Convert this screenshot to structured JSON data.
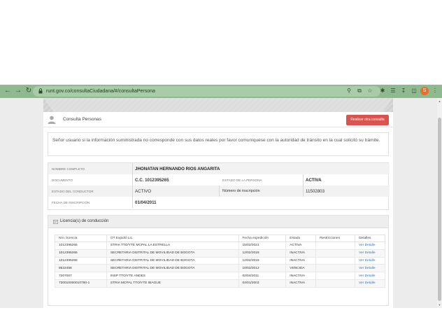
{
  "browser": {
    "url": "runt.gov.co/consultaCiudadana/#/consultaPersona",
    "avatar_letter": "S",
    "accent": "#8fb98f"
  },
  "header": {
    "title": "Consulta Personas",
    "action_button": "Realizar otra consulta"
  },
  "notice": {
    "text": "Señor usuario si la información suministrada no corresponde con sus datos reales por favor comuníquese con la autoridad de tránsito en la cual solicitó su trámite."
  },
  "person": {
    "nombre_label": "NOMBRE COMPLETO",
    "nombre_value": "JHONATAN HERNANDO RIOS ANGARITA",
    "documento_label": "DOCUMENTO",
    "documento_value": "C.C. 1012395265",
    "estado_persona_label": "ESTADO DE LA PERSONA",
    "estado_persona_value": "ACTIVA",
    "estado_conductor_label": "ESTADO DEL CONDUCTOR",
    "estado_conductor_value": "ACTIVO",
    "inscripcion_label": "Número de inscripción",
    "inscripcion_value": "11502803",
    "fecha_label": "FECHA DE INSCRIPCIÓN",
    "fecha_value": "01/04/2011"
  },
  "licenses": {
    "title": "Licencia(s) de conducción",
    "columns": [
      "Nro. licencia",
      "OT Expidió Lic.",
      "Fecha expedición",
      "Estado",
      "Restricciones",
      "Detalles"
    ],
    "rows": [
      [
        "1012395265",
        "STRIA TTO/YTE MCPAL LA ESTRELLA",
        "15/02/2021",
        "ACTIVA",
        "",
        "Ver Detalle"
      ],
      [
        "1012395265",
        "SECRETARIA DISTRITAL DE MOVILIDAD DE BOGOTA",
        "12/02/2018",
        "INACTIVA",
        "",
        "Ver Detalle"
      ],
      [
        "1012395265",
        "SECRETARIA DISTRITAL DE MOVILIDAD DE BOGOTA",
        "12/02/2018",
        "INACTIVA",
        "",
        "Ver Detalle"
      ],
      [
        "8522458",
        "SECRETARIA DISTRITAL DE MOVILIDAD DE BOGOTA",
        "10/02/2012",
        "VENCIDA",
        "",
        "Ver Detalle"
      ],
      [
        "7207067",
        "INSP TTO/YTE ANDES",
        "02/04/2011",
        "INACTIVA",
        "",
        "Ver Detalle"
      ],
      [
        "730010000010780-1",
        "STRIA MCPAL TTO/YTE IBAGUE",
        "04/01/2003",
        "INACTIVA",
        "",
        "Ver Detalle"
      ]
    ]
  },
  "colors": {
    "danger": "#d9534f",
    "link": "#3a74b8"
  }
}
